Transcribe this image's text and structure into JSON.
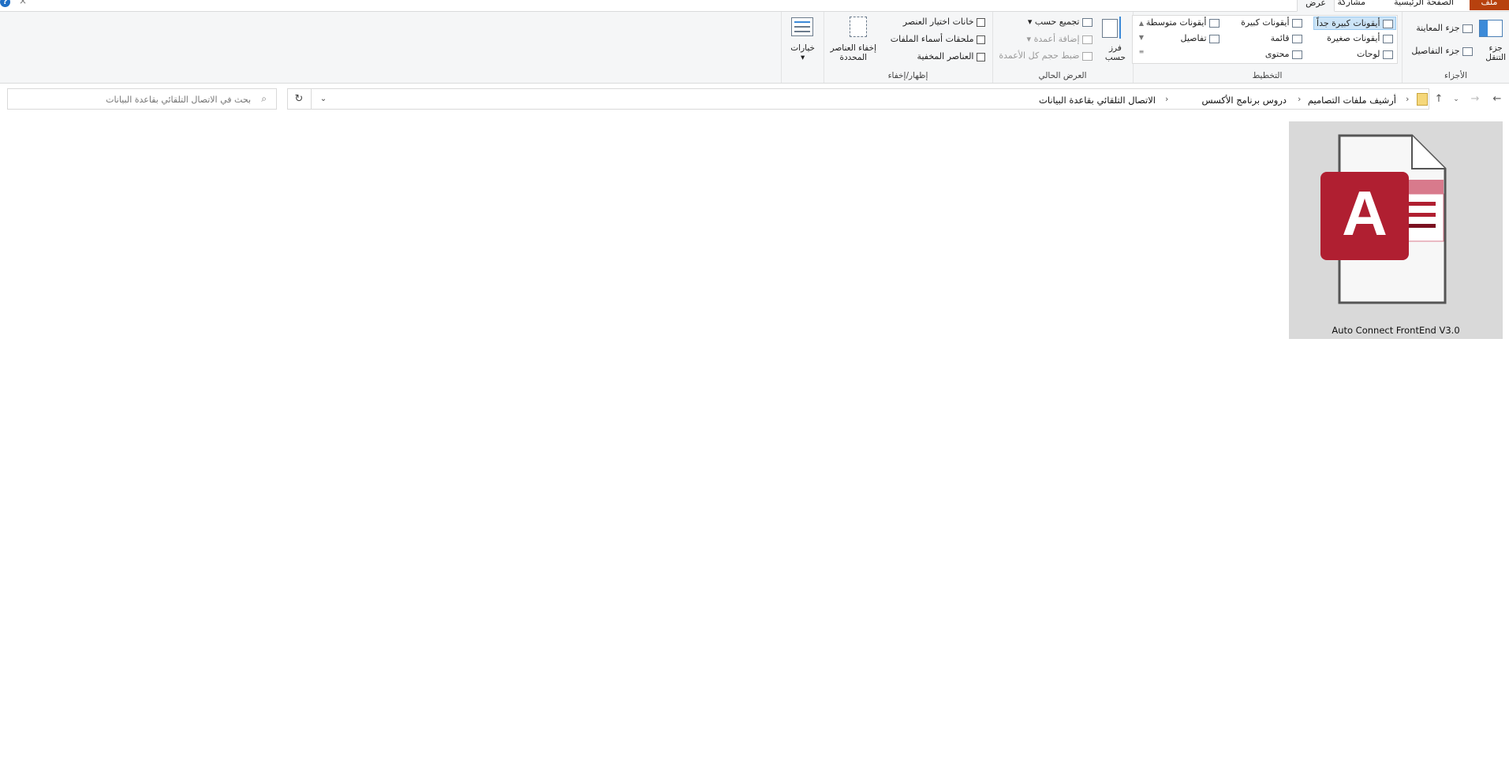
{
  "tabs": {
    "file": "ملف",
    "home": "الصفحة الرئيسية",
    "share": "مشاركة",
    "view": "عرض"
  },
  "ribbon": {
    "panes": {
      "group_label": "الأجزاء",
      "navigation_pane": "جزء\nالتنقل",
      "preview_pane": "جزء المعاينة",
      "details_pane": "جزء التفاصيل"
    },
    "layout": {
      "group_label": "التخطيط",
      "extra_large_icons": "أيقونات كبيرة جداً",
      "large_icons": "أيقونات كبيرة",
      "medium_icons": "أيقونات متوسطة",
      "small_icons": "أيقونات صغيرة",
      "list": "قائمة",
      "details": "تفاصيل",
      "tiles": "لوحات",
      "content": "محتوى"
    },
    "current_view": {
      "group_label": "العرض الحالي",
      "sort_by": "فرز\nحسب",
      "group_by": "تجميع حسب",
      "add_columns": "إضافة أعمدة",
      "size_all_columns": "ضبط حجم كل الأعمدة"
    },
    "show_hide": {
      "group_label": "إظهار/إخفاء",
      "item_checkboxes": "خانات اختيار العنصر",
      "file_name_extensions": "ملحقات أسماء الملفات",
      "hidden_items": "العناصر المخفية",
      "hide_selected": "إخفاء العناصر\nالمحددة"
    },
    "options": "خيارات"
  },
  "address": {
    "crumbs": [
      "أرشيف ملفات التصاميم",
      "دروس برنامج الأكسس",
      "الاتصال التلقائي بقاعدة البيانات"
    ]
  },
  "search": {
    "placeholder": "بحث في الاتصال التلقائي بقاعدة البيانات"
  },
  "files": [
    {
      "name": "Auto Connect FrontEnd V3.0",
      "icon": "access-database-icon",
      "app_letter": "A"
    }
  ],
  "colors": {
    "access_red": "#b01f31",
    "file_tab": "#b7410e",
    "selection": "#cce4f7"
  }
}
